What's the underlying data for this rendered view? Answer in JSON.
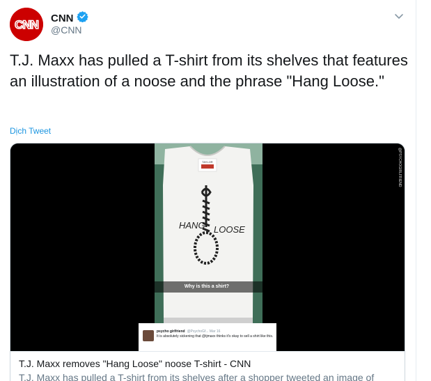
{
  "account": {
    "display_name": "CNN",
    "handle": "@CNN",
    "avatar_text": "CNN",
    "verified": true
  },
  "tweet": {
    "text": "T.J. Maxx has pulled a T-shirt from its shelves that features an illustration of a noose and the phrase \"Hang Loose.\"",
    "translate_label": "Dịch Tweet"
  },
  "card": {
    "title": "T.J. Maxx removes \"Hang Loose\" noose T-shirt - CNN",
    "description": "T.J. Maxx has pulled a T-shirt from its shelves after a shopper tweeted an image of",
    "photo_caption": "Why is this a shirt?",
    "shirt_text_left": "HANG",
    "shirt_text_right": "LOOSE",
    "shirt_tag": "TAYLOR",
    "watermark": "@PSYCHOGIRLFRIEND",
    "embed": {
      "name": "psycho girlfriend",
      "handle": "@PsychoGf...  Mar 16",
      "body": "It is absolutely sickening that @tjmaxx thinks it's okay to sell a shirt like this."
    }
  },
  "colors": {
    "brand_red": "#cc0000",
    "verified_blue": "#1da1f2",
    "link_blue": "#1b95e0"
  },
  "icons": {
    "verified": "verified-badge-icon",
    "chevron": "chevron-down-icon"
  }
}
